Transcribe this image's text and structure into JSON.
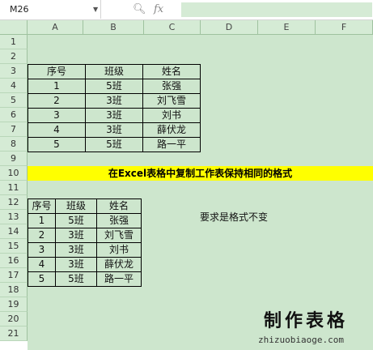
{
  "name_box": {
    "value": "M26",
    "dropdown_icon": "chevron-down-icon"
  },
  "formula_bar": {
    "search_icon": "magnify-icon",
    "fx_label": "fx",
    "content": ""
  },
  "columns": [
    "A",
    "B",
    "C",
    "D",
    "E",
    "F"
  ],
  "rows": [
    "1",
    "2",
    "3",
    "4",
    "5",
    "6",
    "7",
    "8",
    "9",
    "10",
    "11",
    "12",
    "13",
    "14",
    "15",
    "16",
    "17",
    "18",
    "19",
    "20",
    "21"
  ],
  "table1": {
    "headers": [
      "序号",
      "班级",
      "姓名"
    ],
    "rows": [
      [
        "1",
        "5班",
        "张强"
      ],
      [
        "2",
        "3班",
        "刘飞雪"
      ],
      [
        "3",
        "3班",
        "刘书"
      ],
      [
        "4",
        "3班",
        "薛伏龙"
      ],
      [
        "5",
        "5班",
        "路一平"
      ]
    ]
  },
  "banner": "在Excel表格中复制工作表保持相同的格式",
  "table2": {
    "headers": [
      "序号",
      "班级",
      "姓名"
    ],
    "rows": [
      [
        "1",
        "5班",
        "张强"
      ],
      [
        "2",
        "3班",
        "刘飞雪"
      ],
      [
        "3",
        "3班",
        "刘书"
      ],
      [
        "4",
        "3班",
        "薛伏龙"
      ],
      [
        "5",
        "5班",
        "路一平"
      ]
    ]
  },
  "note": "要求是格式不变",
  "watermark": {
    "logo_text": "制作表格",
    "url": "zhizuobiaoge.com"
  },
  "colors": {
    "grid_bg": "#cde6cd",
    "header_bg": "#d5ebd5",
    "banner_bg": "#ffff00"
  }
}
